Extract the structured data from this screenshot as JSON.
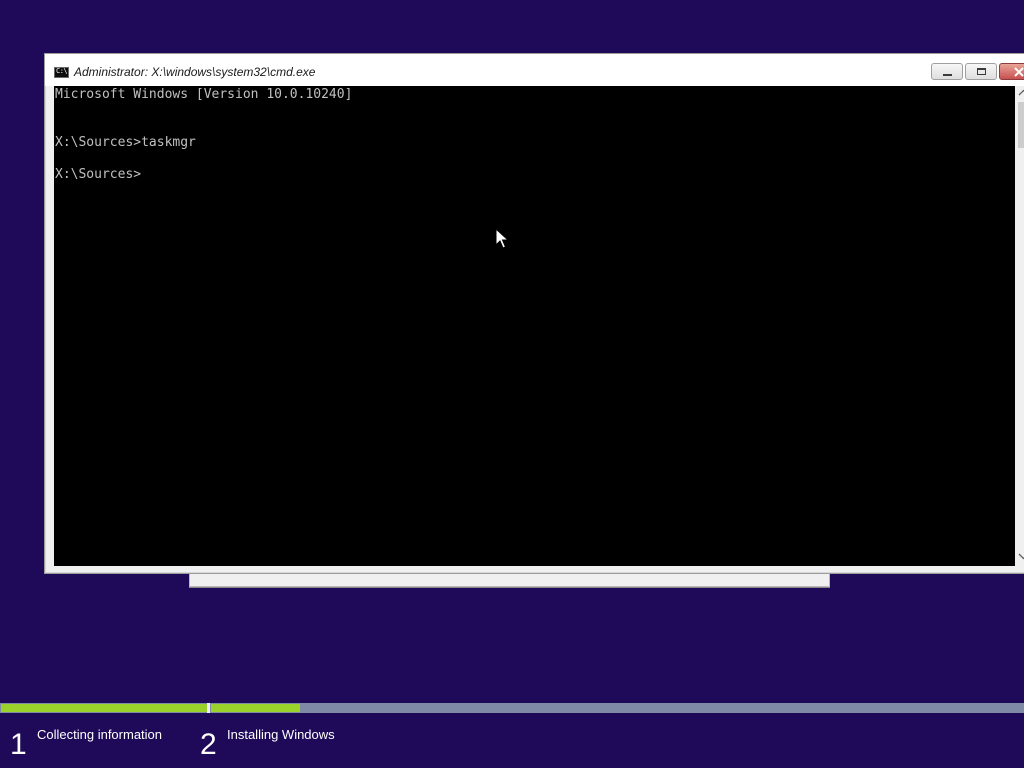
{
  "window": {
    "title": "Administrator: X:\\windows\\system32\\cmd.exe",
    "icon": "console-icon",
    "icon_text": "C:\\"
  },
  "console": {
    "lines": [
      "Microsoft Windows [Version 10.0.10240]",
      "",
      "X:\\Sources>taskmgr",
      "",
      "X:\\Sources>"
    ]
  },
  "setup": {
    "progress": {
      "step1_fraction": 1.0,
      "step2_fraction": 0.11
    },
    "steps": [
      {
        "number": "1",
        "label": "Collecting information"
      },
      {
        "number": "2",
        "label": "Installing Windows"
      }
    ]
  },
  "colors": {
    "desktop": "#1e0a58",
    "progress_fill": "#9bd12b",
    "progress_track": "#7f8ba6",
    "console_bg": "#000000",
    "console_text": "#c0c0c0"
  }
}
